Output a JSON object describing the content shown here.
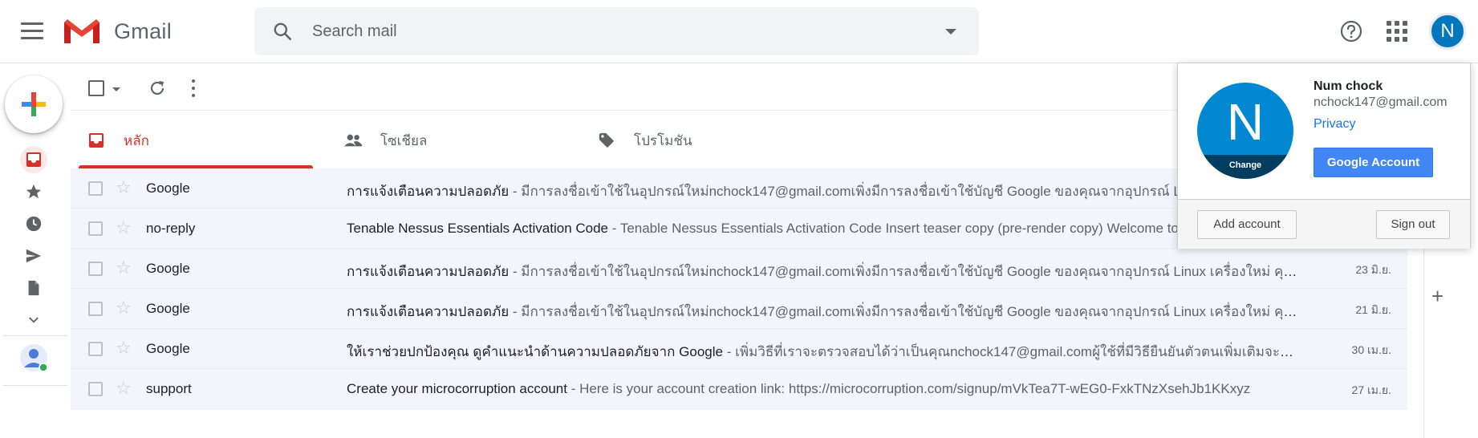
{
  "app": {
    "name": "Gmail"
  },
  "search": {
    "placeholder": "Search mail"
  },
  "user": {
    "initial": "N",
    "name": "Num chock",
    "email": "nchock147@gmail.com"
  },
  "account_menu": {
    "change_label": "Change",
    "privacy_label": "Privacy",
    "google_account_label": "Google Account",
    "add_account_label": "Add account",
    "sign_out_label": "Sign out"
  },
  "tabs": [
    {
      "label": "หลัก",
      "icon": "inbox-icon",
      "active": true
    },
    {
      "label": "โซเชียล",
      "icon": "people-icon",
      "active": false
    },
    {
      "label": "โปรโมชัน",
      "icon": "tag-icon",
      "active": false
    }
  ],
  "emails": [
    {
      "sender": "Google",
      "subject": "การแจ้งเตือนความปลอดภัย",
      "snippet": " - มีการลงชื่อเข้าใช้ในอุปกรณ์ใหม่nchock147@gmail.comเพิ่งมีการลงชื่อเข้าใช้บัญชี Google ของคุณจากอุปกรณ์ Linux เครื่องใหม่ คุณได้รับอีเมลนี้เนื่องจาก",
      "date": ""
    },
    {
      "sender": "no-reply",
      "subject": "Tenable Nessus Essentials Activation Code",
      "snippet": " - Tenable Nessus Essentials Activation Code Insert teaser copy (pre-render copy) Welcome to Nessus Essentials",
      "date": ""
    },
    {
      "sender": "Google",
      "subject": "การแจ้งเตือนความปลอดภัย",
      "snippet": " - มีการลงชื่อเข้าใช้ในอุปกรณ์ใหม่nchock147@gmail.comเพิ่งมีการลงชื่อเข้าใช้บัญชี Google ของคุณจากอุปกรณ์ Linux เครื่องใหม่ คุณได้รับอีเมลนี้เนื่องจาก",
      "date": "23 มิ.ย."
    },
    {
      "sender": "Google",
      "subject": "การแจ้งเตือนความปลอดภัย",
      "snippet": " - มีการลงชื่อเข้าใช้ในอุปกรณ์ใหม่nchock147@gmail.comเพิ่งมีการลงชื่อเข้าใช้บัญชี Google ของคุณจากอุปกรณ์ Linux เครื่องใหม่ คุณได้รับอีเมลนี้เนื่องจาก",
      "date": "21 มิ.ย."
    },
    {
      "sender": "Google",
      "subject": "ให้เราช่วยปกป้องคุณ ดูคำแนะนำด้านความปลอดภัยจาก Google",
      "snippet": " - เพิ่มวิธีที่เราจะตรวจสอบได้ว่าเป็นคุณnchock147@gmail.comผู้ใช้ที่มีวิธียืนยันตัวตนเพิ่มเติมจะมีโอกาสสูงขึ้น",
      "date": "30 เม.ย."
    },
    {
      "sender": "support",
      "subject": "Create your microcorruption account",
      "snippet": " - Here is your account creation link: https://microcorruption.com/signup/mVkTea7T-wEG0-FxkTNzXsehJb1KKxyz",
      "date": "27 เม.ย."
    }
  ],
  "colors": {
    "brand_red": "#d93025",
    "accent_blue": "#4285f4",
    "avatar_blue": "#0288d1"
  }
}
